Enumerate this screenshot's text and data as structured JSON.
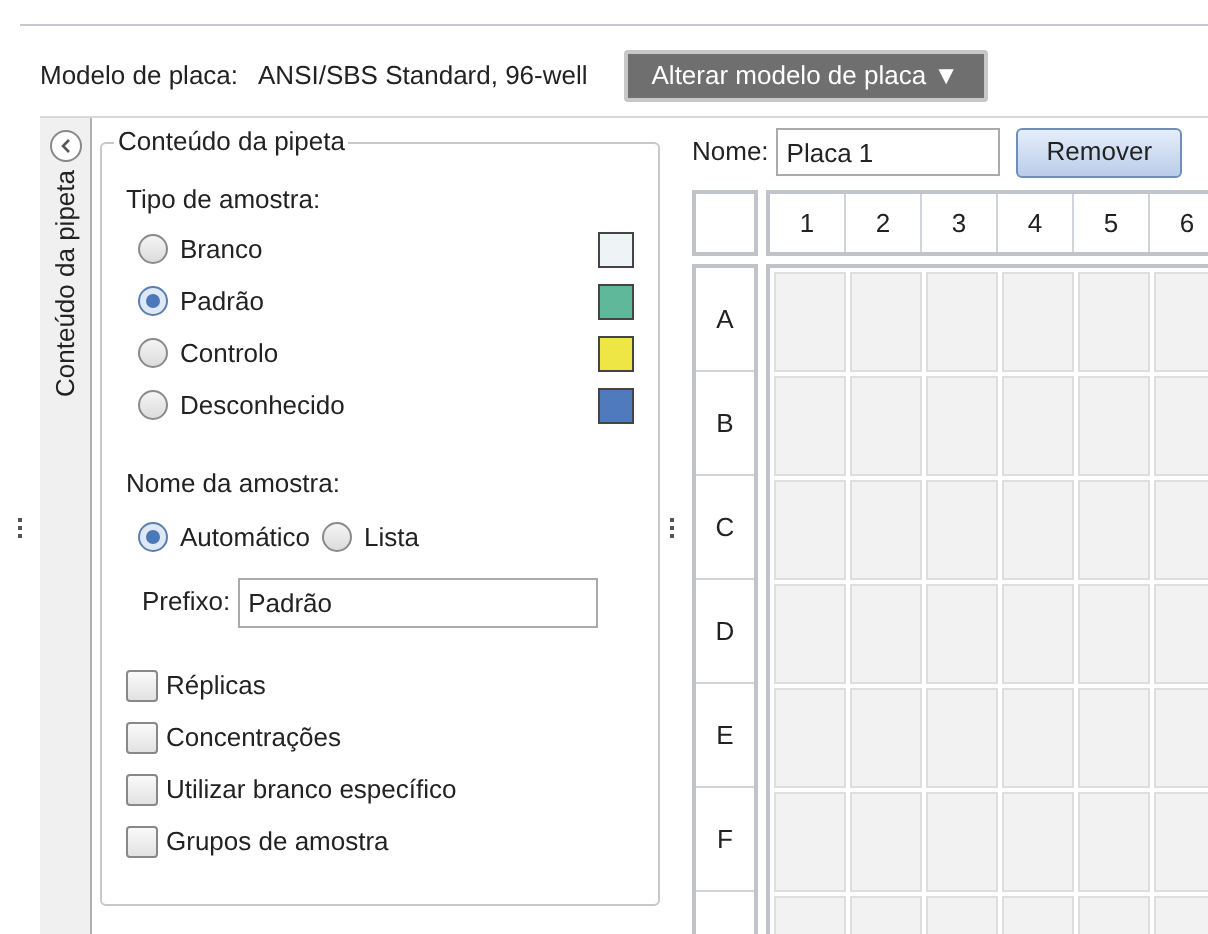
{
  "plate_model": {
    "label": "Modelo de placa:",
    "value": "ANSI/SBS Standard, 96-well",
    "button": "Alterar modelo de placa ▼"
  },
  "side_tab": {
    "label": "Conteúdo da pipeta"
  },
  "panel": {
    "title": "Conteúdo da pipeta",
    "sample_type": {
      "label": "Tipo de amostra:",
      "options": [
        {
          "label": "Branco",
          "selected": false,
          "color": "#eef4f6"
        },
        {
          "label": "Padrão",
          "selected": true,
          "color": "#5fb89a"
        },
        {
          "label": "Controlo",
          "selected": false,
          "color": "#ede645"
        },
        {
          "label": "Desconhecido",
          "selected": false,
          "color": "#4f7bbd"
        }
      ]
    },
    "sample_name": {
      "label": "Nome da amostra:",
      "options": [
        {
          "label": "Automático",
          "selected": true
        },
        {
          "label": "Lista",
          "selected": false
        }
      ]
    },
    "prefix": {
      "label": "Prefixo:",
      "value": "Padrão"
    },
    "checkboxes": [
      {
        "label": "Réplicas",
        "checked": false
      },
      {
        "label": "Concentrações",
        "checked": false
      },
      {
        "label": "Utilizar branco específico",
        "checked": false
      },
      {
        "label": "Grupos de amostra",
        "checked": false
      }
    ]
  },
  "plate": {
    "name_label": "Nome:",
    "name_value": "Placa 1",
    "remove_button": "Remover",
    "columns": [
      "1",
      "2",
      "3",
      "4",
      "5",
      "6"
    ],
    "rows": [
      "A",
      "B",
      "C",
      "D",
      "E",
      "F"
    ]
  }
}
